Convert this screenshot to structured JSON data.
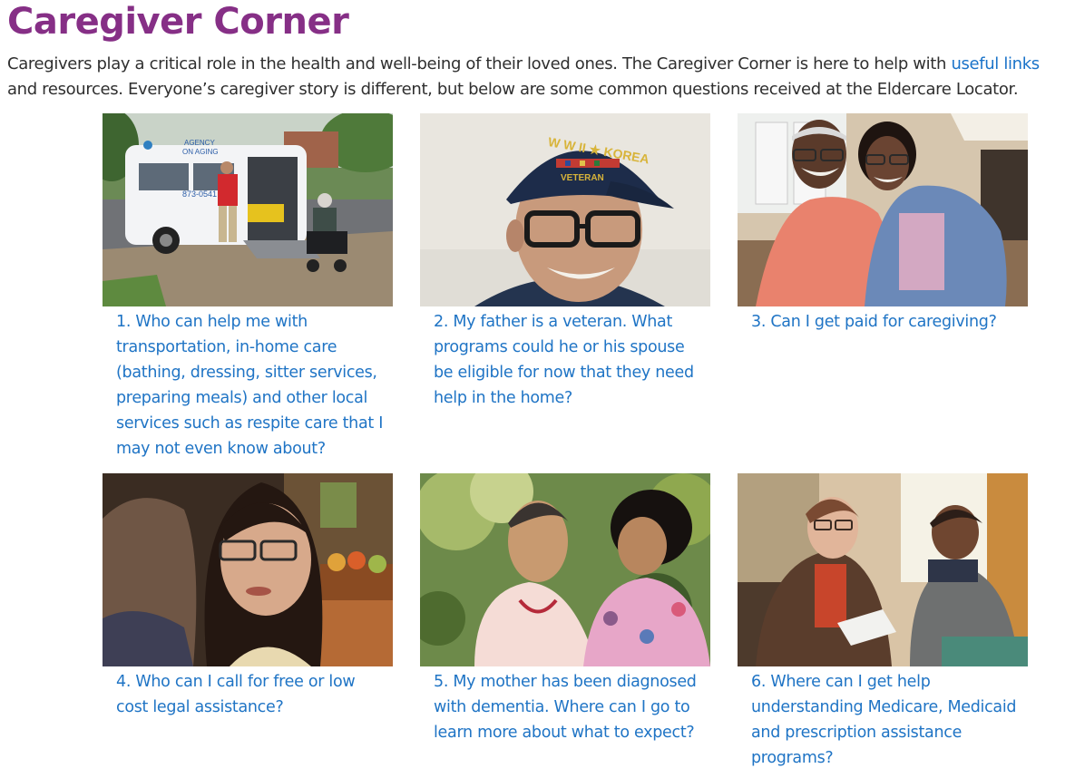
{
  "header": {
    "title": "Caregiver Corner"
  },
  "intro": {
    "text_before": "Caregivers play a critical role in the health and well-being of their loved ones. The Caregiver Corner is here to help with ",
    "link_text": "useful links",
    "text_after": " and resources. Everyone’s caregiver story is different, but below are some common questions received at the Eldercare Locator."
  },
  "colors": {
    "title": "#862f86",
    "link": "#1f74c5",
    "body_text": "#2f2f2f"
  },
  "cards": [
    {
      "image": "van-wheelchair-lift-photo",
      "van_text_1": "AGENCY",
      "van_text_2": "ON AGING",
      "van_text_3": "873-0541",
      "caption": "1. Who can help me with transportation, in-home care (bathing, dressing, sitter services, preparing meals) and other local services such as respite care that I may not even know about?"
    },
    {
      "image": "veteran-portrait-photo",
      "cap_text_1": "W W II ★ KOREA",
      "cap_text_2": "VETERAN",
      "caption": "2. My father is a veteran. What programs could he or his spouse be eligible for now that they need help in the home?"
    },
    {
      "image": "senior-couple-photo",
      "caption": "3. Can I get paid for caregiving?"
    },
    {
      "image": "woman-with-glasses-photo",
      "caption": "4. Who can I call for free or low cost legal assistance?"
    },
    {
      "image": "two-senior-women-photo",
      "caption": "5. My mother has been diagnosed with dementia. Where can I go to learn more about what to expect?"
    },
    {
      "image": "counselor-meeting-photo",
      "caption": "6. Where can I get help understanding Medicare, Medicaid and prescription assistance programs?"
    }
  ]
}
